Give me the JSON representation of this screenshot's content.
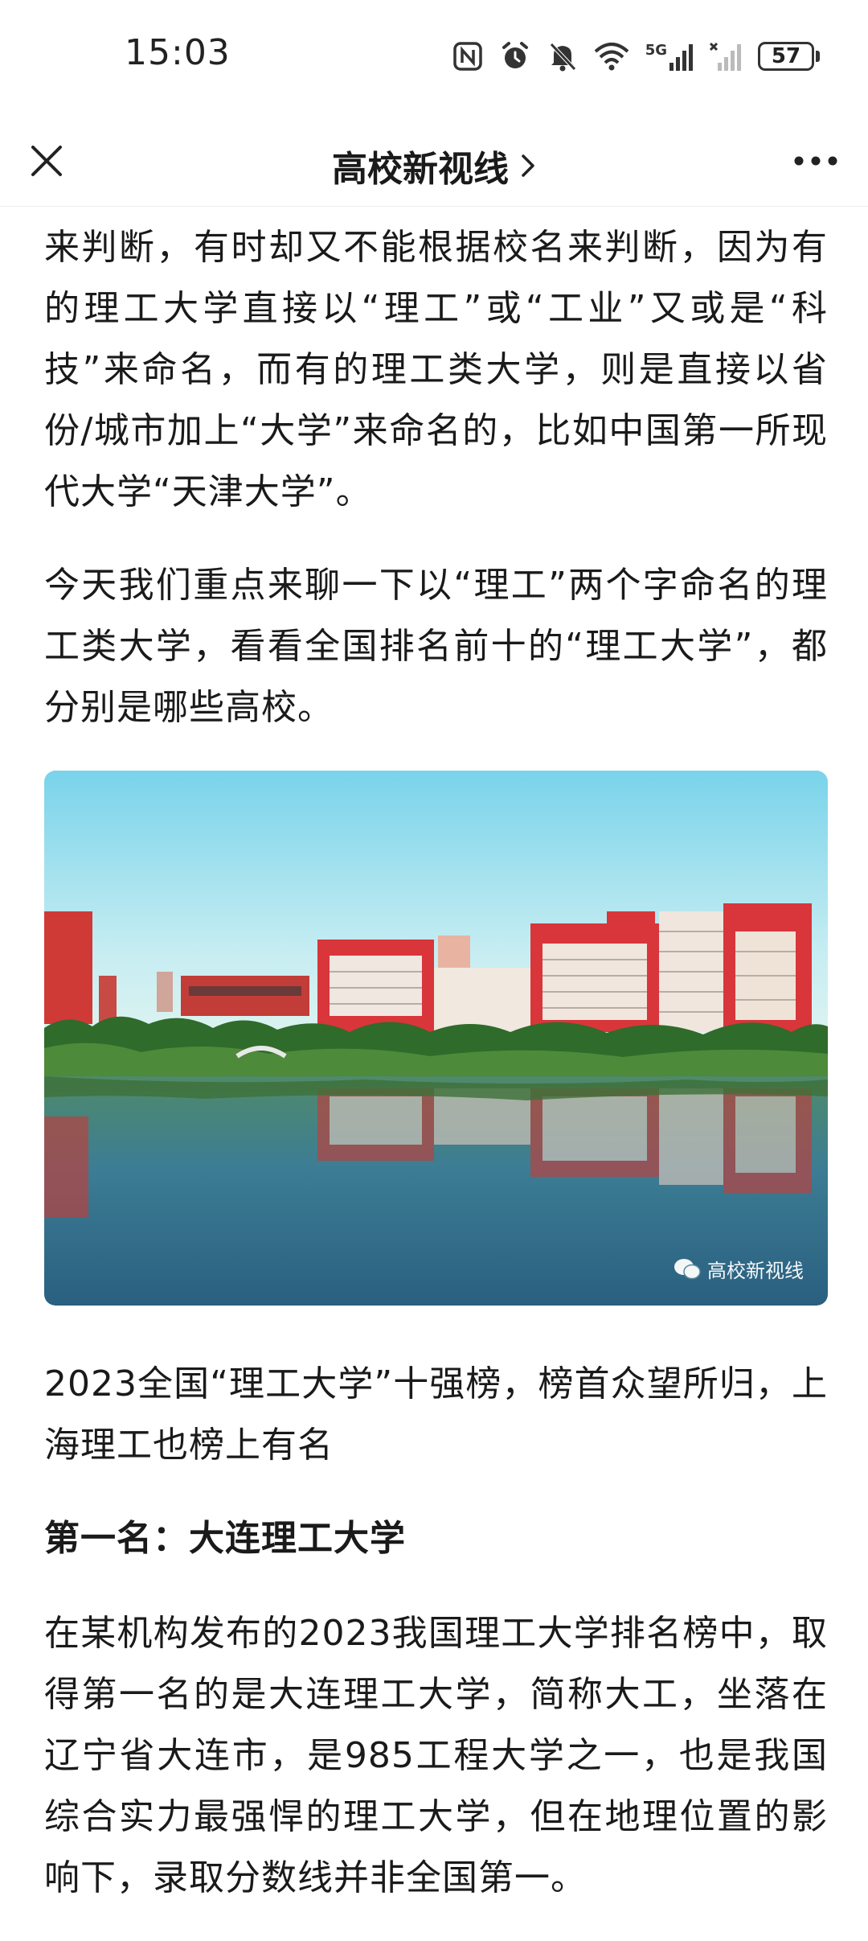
{
  "status_bar": {
    "time": "15:03",
    "battery": "57",
    "icons": [
      "nfc-icon",
      "alarm-icon",
      "mute-icon",
      "wifi-icon",
      "5g-signal-icon",
      "no-signal-icon",
      "battery-icon"
    ],
    "network_label": "5G"
  },
  "nav": {
    "title": "高校新视线",
    "close_icon": "close-icon",
    "chevron_icon": "chevron-right-icon",
    "more_icon": "more-icon"
  },
  "article": {
    "p1": "来判断，有时却又不能根据校名来判断，因为有的理工大学直接以“理工”或“工业”又或是“科技”来命名，而有的理工类大学，则是直接以省份/城市加上“大学”来命名的，比如中国第一所现代大学“天津大学”。",
    "p2": "今天我们重点来聊一下以“理工”两个字命名的理工类大学，看看全国排名前十的“理工大学”，都分别是哪些高校。",
    "image_watermark": "高校新视线",
    "p3": "2023全国“理工大学”十强榜，榜首众望所归，上海理工也榜上有名",
    "heading1": "第一名：大连理工大学",
    "p4": "在某机构发布的2023我国理工大学排名榜中，取得第一名的是大连理工大学，简称大工，坐落在辽宁省大连市，是985工程大学之一，也是我国综合实力最强悍的理工大学，但在地理位置的影响下，录取分数线并非全国第一。"
  },
  "colors": {
    "text": "#1a1a1a",
    "building_red": "#d8363a",
    "sky_top": "#7fd6ea",
    "water": "#2f6f8f"
  }
}
